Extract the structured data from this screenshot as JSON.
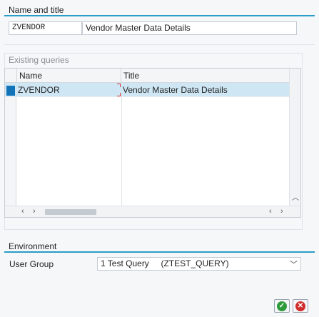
{
  "name_section": {
    "title": "Name and title",
    "name_value": "ZVENDOR",
    "title_value": "Vendor Master Data Details"
  },
  "queries": {
    "caption": "Existing queries",
    "columns": [
      "Name",
      "Title"
    ],
    "rows": [
      {
        "name": "ZVENDOR",
        "title": "Vendor Master Data Details",
        "selected": true
      }
    ]
  },
  "environment": {
    "title": "Environment",
    "user_group_label": "User Group",
    "user_group_value": "1 Test Query     (ZTEST_QUERY)"
  },
  "icons": {
    "confirm": "check-icon",
    "cancel": "cancel-icon",
    "scroll_up": "chevron-up-icon",
    "scroll_down": "chevron-down-icon",
    "scroll_left": "chevron-left-icon",
    "scroll_right": "chevron-right-icon"
  },
  "colors": {
    "accent": "#2b9cc8",
    "selection": "#cfe7f5",
    "row_marker": "#1273b8",
    "confirm_green": "#2e9a3a",
    "cancel_red": "#d22d2d"
  }
}
